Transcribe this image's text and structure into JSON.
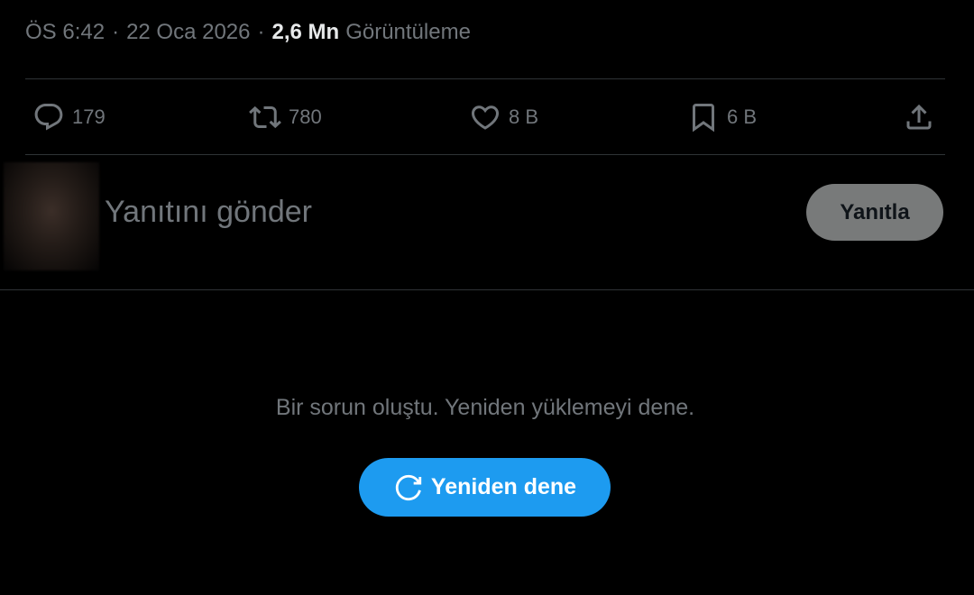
{
  "meta": {
    "time": "ÖS 6:42",
    "separator1": "·",
    "date": "22 Oca 2026",
    "separator2": "·",
    "views_count": "2,6 Mn",
    "views_label": "Görüntüleme"
  },
  "actions": {
    "reply_count": "179",
    "retweet_count": "780",
    "like_count": "8 B",
    "bookmark_count": "6 B",
    "icons": [
      "reply-icon",
      "retweet-icon",
      "like-icon",
      "bookmark-icon",
      "share-icon"
    ]
  },
  "compose": {
    "placeholder": "Yanıtını gönder",
    "reply_button": "Yanıtla"
  },
  "error": {
    "message": "Bir sorun oluştu. Yeniden yüklemeyi dene.",
    "retry_label": "Yeniden dene"
  },
  "colors": {
    "background": "#000000",
    "muted": "#71767b",
    "accent": "#1d9bf0",
    "divider": "#2f3336"
  }
}
